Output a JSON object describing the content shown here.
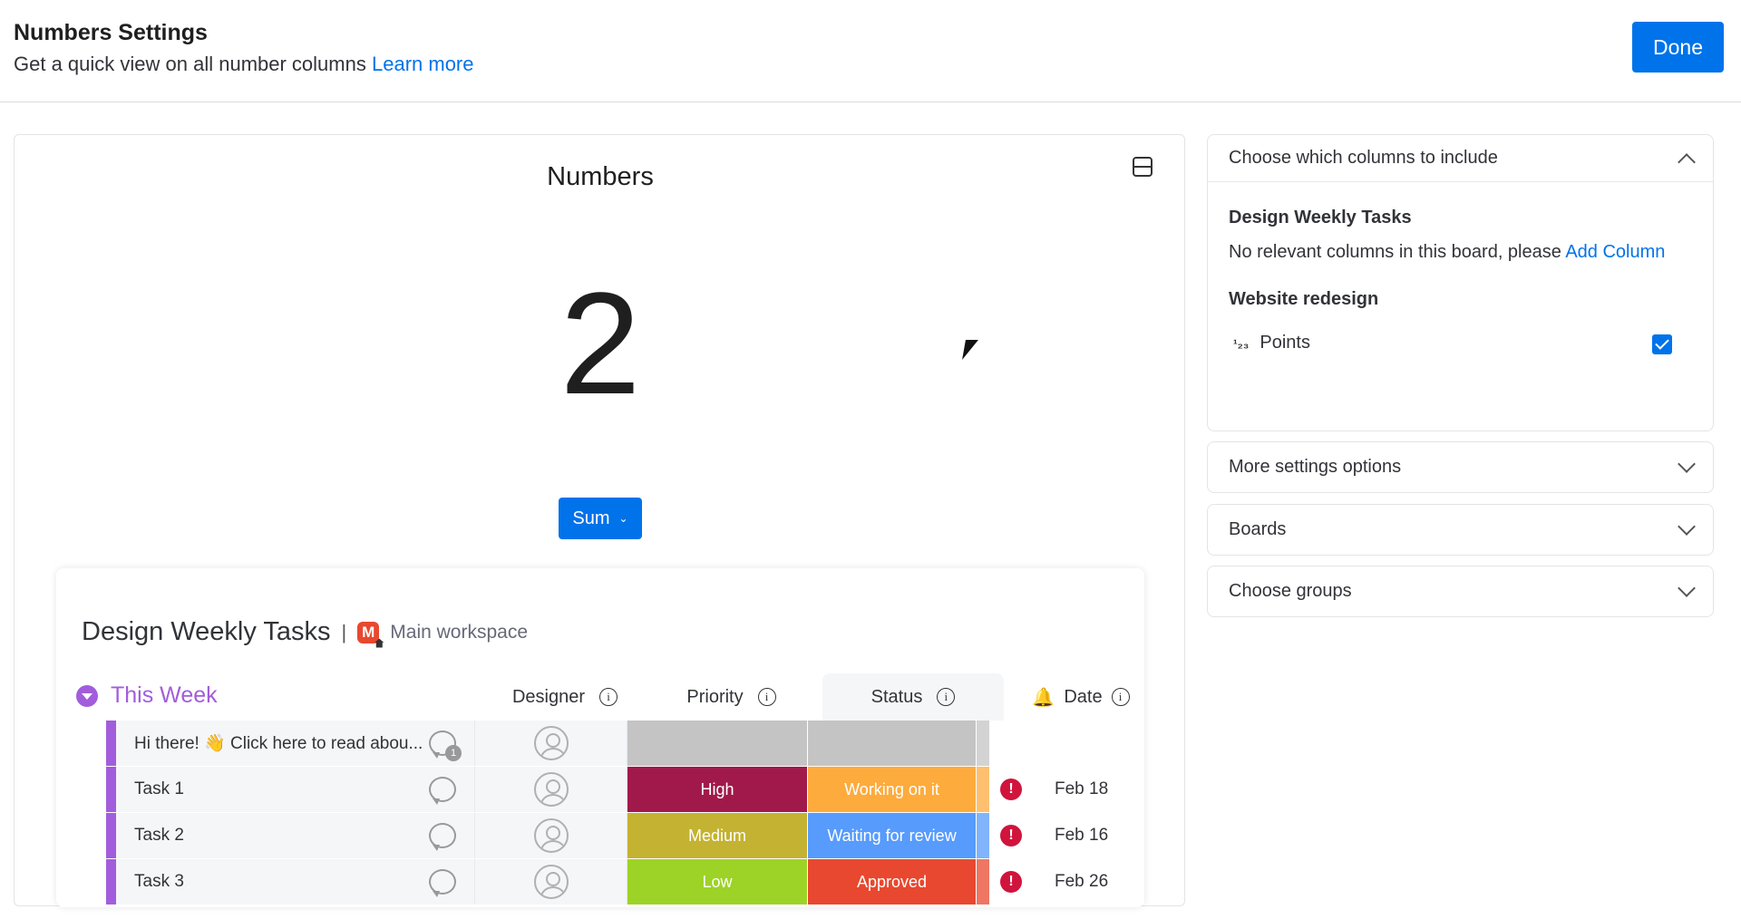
{
  "header": {
    "title": "Numbers Settings",
    "subtitle": "Get a quick view on all number columns",
    "learn_more": "Learn more",
    "done_label": "Done"
  },
  "widget": {
    "title": "Numbers",
    "value": "2",
    "function_label": "Sum",
    "layout_icon": "layout-split-icon"
  },
  "board": {
    "title": "Design Weekly Tasks",
    "separator": "|",
    "workspace_badge": "M",
    "workspace": "Main workspace",
    "group": {
      "name": "This Week",
      "color": "#a25ddc"
    },
    "columns": [
      "Designer",
      "Priority",
      "Status",
      "Date"
    ],
    "rows": [
      {
        "name": "Hi there! 👋 Click here to read abou...",
        "updates": "1",
        "priority": "",
        "priority_color": "#c4c4c4",
        "status": "",
        "status_color": "#c4c4c4",
        "date": "",
        "alert": ""
      },
      {
        "name": "Task 1",
        "priority": "High",
        "priority_color": "#a1194b",
        "status": "Working on it",
        "status_color": "#fdab3d",
        "date": "Feb 18",
        "alert": "!"
      },
      {
        "name": "Task 2",
        "priority": "Medium",
        "priority_color": "#c4b232",
        "status": "Waiting for review",
        "status_color": "#579bfc",
        "date": "Feb 16",
        "alert": "!"
      },
      {
        "name": "Task 3",
        "priority": "Low",
        "priority_color": "#9cd326",
        "status": "Approved",
        "status_color": "#e8482f",
        "date": "Feb 26",
        "alert": "!"
      }
    ]
  },
  "settings": {
    "columns_section": {
      "title": "Choose which columns to include",
      "boards": [
        {
          "name": "Design Weekly Tasks",
          "message": "No relevant columns in this board, please",
          "link": "Add Column"
        },
        {
          "name": "Website redesign",
          "column_icon": "¹₂₃",
          "column": "Points",
          "checked": true
        }
      ]
    },
    "more_settings": "More settings options",
    "boards": "Boards",
    "groups": "Choose groups"
  },
  "colors": {
    "primary": "#0073ea",
    "alert": "#d0143c"
  }
}
